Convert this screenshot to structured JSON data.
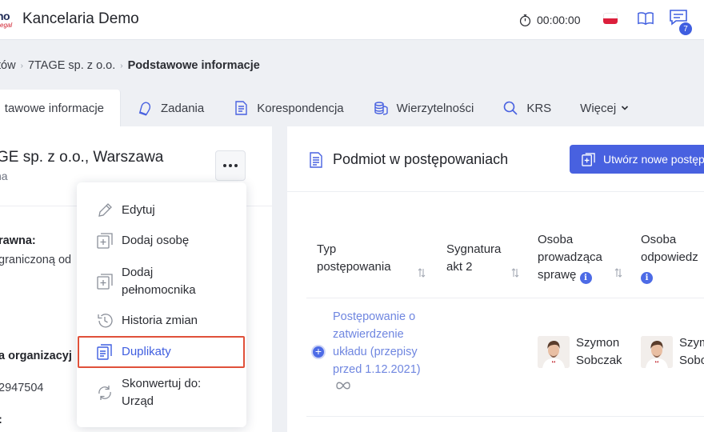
{
  "header": {
    "logo_top": "no",
    "logo_bottom": "egal",
    "app_title": "Kancelaria Demo",
    "timer": "00:00:00",
    "notifications_count": "7"
  },
  "breadcrumb": [
    "tów",
    "7TAGE sp. z o.o.",
    "Podstawowe informacje"
  ],
  "tabs": [
    {
      "label": "tawowe informacje",
      "icon": "none"
    },
    {
      "label": "Zadania",
      "icon": "bell-icon"
    },
    {
      "label": "Korespondencja",
      "icon": "document-icon"
    },
    {
      "label": "Wierzytelności",
      "icon": "coins-icon"
    },
    {
      "label": "KRS",
      "icon": "search-icon"
    },
    {
      "label": "Więcej",
      "icon": "chevron-down-icon"
    }
  ],
  "entity": {
    "name": "GE sp. z o.o., Warszawa",
    "subtitle": "na",
    "field1_label": "rawna:",
    "field1_value": "graniczoną od",
    "field2_label": "a organizacyj",
    "field2_value": "2947504",
    "field3_label": ":"
  },
  "menu": {
    "items": [
      {
        "label": "Edytuj",
        "icon": "pencil-icon"
      },
      {
        "label": "Dodaj osobę",
        "icon": "add-person-icon"
      },
      {
        "label": "Dodaj pełnomocnika",
        "icon": "add-proxy-icon"
      },
      {
        "label": "Historia zmian",
        "icon": "history-icon"
      },
      {
        "label": "Duplikaty",
        "icon": "duplicates-icon",
        "highlighted": true
      },
      {
        "label": "Skonwertuj do: Urząd",
        "icon": "convert-icon"
      }
    ]
  },
  "panel": {
    "title": "Podmiot w postępowaniach",
    "new_button": "Utwórz nowe postęp",
    "columns": [
      {
        "label": "Typ postępowania",
        "sortable": true
      },
      {
        "label": "Sygnatura akt 2",
        "sortable": true
      },
      {
        "label": "Osoba prowadząca sprawę",
        "sortable": true,
        "info": true
      },
      {
        "label": "Osoba odpowiedz",
        "info": true
      }
    ],
    "row": {
      "case_type": "Postępowanie o zatwierdzenie układu (przepisy przed 1.12.2021)",
      "lead_person": "Szymon Sobczak",
      "responsible_person": "Szym Sobo"
    }
  },
  "colors": {
    "accent": "#4861e0",
    "link": "#6f86e0",
    "highlight_border": "#e0513a",
    "flag_red": "#dc1f3c"
  }
}
